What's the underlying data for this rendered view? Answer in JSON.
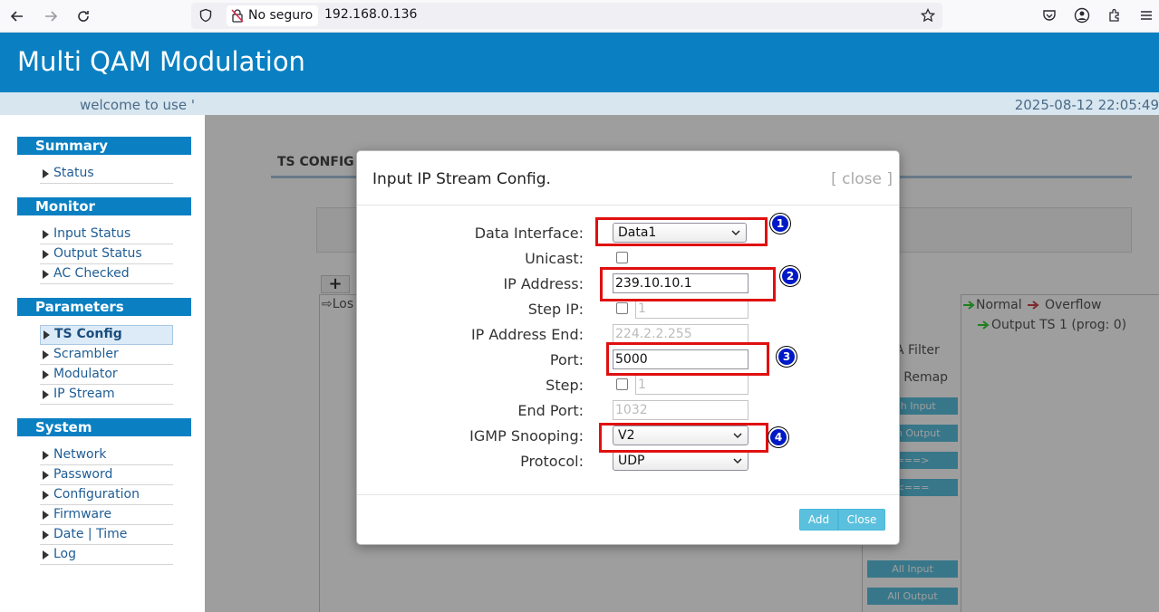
{
  "browser": {
    "security_label": "No seguro",
    "url": "192.168.0.136"
  },
  "header": {
    "title": "Multi QAM Modulation",
    "welcome": "welcome to use '",
    "datetime": "2025-08-12 22:05:49"
  },
  "sidebar": {
    "summary": {
      "title": "Summary",
      "items": [
        "Status"
      ]
    },
    "monitor": {
      "title": "Monitor",
      "items": [
        "Input Status",
        "Output Status",
        "AC Checked"
      ]
    },
    "parameters": {
      "title": "Parameters",
      "items": [
        "TS Config",
        "Scrambler",
        "Modulator",
        "IP Stream"
      ],
      "active": "TS Config"
    },
    "system": {
      "title": "System",
      "items": [
        "Network",
        "Password",
        "Configuration",
        "Firmware",
        "Date | Time",
        "Log"
      ]
    }
  },
  "background": {
    "tab": "TS CONFIG",
    "plus": "+",
    "left_panel_text": "⇨Los",
    "legend_normal": "Normal",
    "legend_overflow": "Overflow",
    "output_ts": "Output TS 1 (prog: 0)",
    "filter_label": "A Filter",
    "remap_label": "D Remap",
    "buttons": [
      "esh Input",
      "esh Output",
      "===>",
      "<===",
      "All Input",
      "All Output"
    ]
  },
  "modal": {
    "title": "Input IP Stream Config.",
    "close_link": "[ close ]",
    "fields": {
      "data_interface": {
        "label": "Data Interface:",
        "value": "Data1"
      },
      "unicast": {
        "label": "Unicast:"
      },
      "ip_address": {
        "label": "IP Address:",
        "value": "239.10.10.1"
      },
      "step_ip": {
        "label": "Step IP:",
        "value": "1"
      },
      "ip_address_end": {
        "label": "IP Address End:",
        "value": "224.2.2.255"
      },
      "port": {
        "label": "Port:",
        "value": "5000"
      },
      "step": {
        "label": "Step:",
        "value": "1"
      },
      "end_port": {
        "label": "End Port:",
        "value": "1032"
      },
      "igmp_snooping": {
        "label": "IGMP Snooping:",
        "value": "V2"
      },
      "protocol": {
        "label": "Protocol:",
        "value": "UDP"
      }
    },
    "add_label": "Add",
    "close_label": "Close",
    "badges": [
      "1",
      "2",
      "3",
      "4"
    ],
    "annotation_color": "#e01010",
    "badge_color": "#0019c6"
  }
}
